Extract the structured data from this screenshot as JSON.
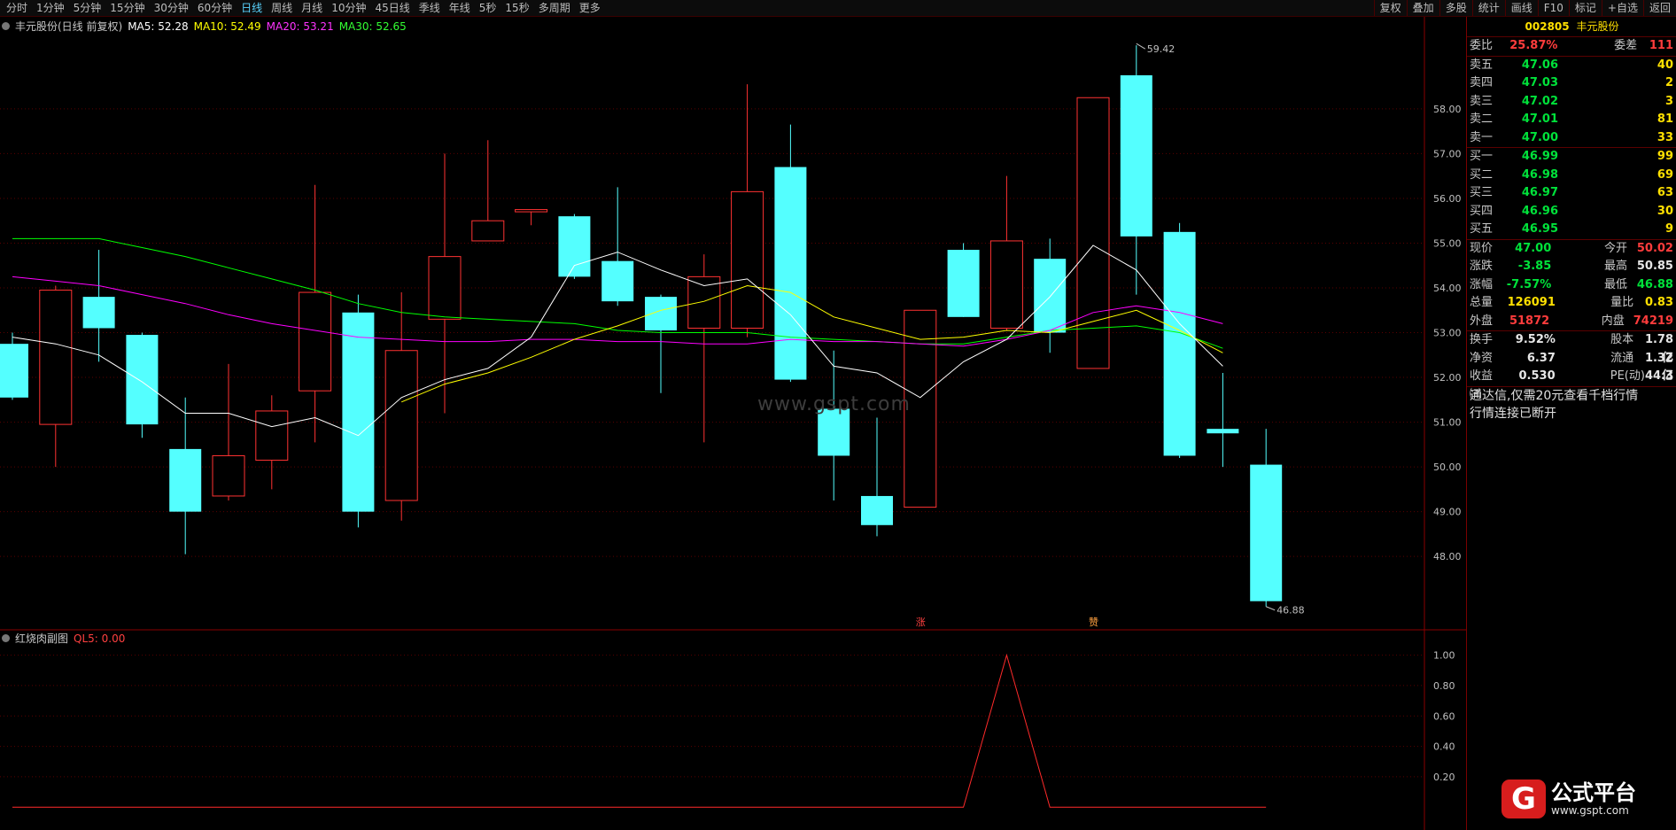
{
  "toolbar": {
    "periods": [
      "分时",
      "1分钟",
      "5分钟",
      "15分钟",
      "30分钟",
      "60分钟",
      "日线",
      "周线",
      "月线",
      "10分钟",
      "45日线",
      "季线",
      "年线",
      "5秒",
      "15秒",
      "多周期",
      "更多"
    ],
    "active_period": "日线",
    "buttons": [
      "复权",
      "叠加",
      "多股",
      "统计",
      "画线",
      "F10",
      "标记",
      "+自选",
      "返回"
    ]
  },
  "legend": {
    "title": "丰元股份(日线 前复权)",
    "ma5": "MA5: 52.28",
    "ma10": "MA10: 52.49",
    "ma20": "MA20: 53.21",
    "ma30": "MA30: 52.65"
  },
  "sub_legend": {
    "title": "红烧肉副图",
    "ql5": "QL5: 0.00"
  },
  "watermark": "www.gspt.com",
  "markers": {
    "rise": "涨",
    "other": "赞"
  },
  "high_label": "59.42",
  "low_label": "46.88",
  "colors": {
    "up": "#ff3232",
    "down": "#54ffff",
    "ma5": "#ffffff",
    "ma10": "#ffff00",
    "ma20": "#ff00ff",
    "ma30": "#00ff00",
    "grid": "#5a0000"
  },
  "chart_data": {
    "type": "candlestick",
    "y_ticks": [
      58.0,
      57.0,
      56.0,
      55.0,
      54.0,
      53.0,
      52.0,
      51.0,
      50.0,
      49.0,
      48.0
    ],
    "ylim": [
      46.4,
      59.7
    ],
    "candles": [
      {
        "o": 52.75,
        "c": 51.55,
        "h": 53.0,
        "l": 51.5
      },
      {
        "o": 50.95,
        "c": 53.95,
        "h": 54.05,
        "l": 50.0
      },
      {
        "o": 53.8,
        "c": 53.1,
        "h": 54.85,
        "l": 52.35
      },
      {
        "o": 52.95,
        "c": 50.95,
        "h": 53.0,
        "l": 50.65
      },
      {
        "o": 50.4,
        "c": 49.0,
        "h": 51.55,
        "l": 48.05
      },
      {
        "o": 49.35,
        "c": 50.25,
        "h": 52.3,
        "l": 49.25
      },
      {
        "o": 50.15,
        "c": 51.25,
        "h": 51.6,
        "l": 49.5
      },
      {
        "o": 51.7,
        "c": 53.9,
        "h": 56.3,
        "l": 50.55
      },
      {
        "o": 53.45,
        "c": 49.0,
        "h": 53.85,
        "l": 48.65
      },
      {
        "o": 49.25,
        "c": 52.6,
        "h": 53.9,
        "l": 48.8
      },
      {
        "o": 53.3,
        "c": 54.7,
        "h": 57.0,
        "l": 51.2
      },
      {
        "o": 55.05,
        "c": 55.5,
        "h": 57.3,
        "l": 55.05
      },
      {
        "o": 55.7,
        "c": 55.75,
        "h": 55.75,
        "l": 55.4
      },
      {
        "o": 55.6,
        "c": 54.25,
        "h": 55.65,
        "l": 54.2
      },
      {
        "o": 54.6,
        "c": 53.7,
        "h": 56.25,
        "l": 53.6
      },
      {
        "o": 53.8,
        "c": 53.05,
        "h": 53.85,
        "l": 51.65
      },
      {
        "o": 53.1,
        "c": 54.25,
        "h": 54.75,
        "l": 50.55
      },
      {
        "o": 53.1,
        "c": 56.15,
        "h": 58.55,
        "l": 52.9
      },
      {
        "o": 56.7,
        "c": 51.95,
        "h": 57.65,
        "l": 51.9
      },
      {
        "o": 51.3,
        "c": 50.25,
        "h": 52.6,
        "l": 49.25
      },
      {
        "o": 49.35,
        "c": 48.7,
        "h": 51.1,
        "l": 48.45
      },
      {
        "o": 49.1,
        "c": 53.5,
        "h": 53.5,
        "l": 49.1
      },
      {
        "o": 54.85,
        "c": 53.35,
        "h": 55.0,
        "l": 53.35
      },
      {
        "o": 53.1,
        "c": 55.05,
        "h": 56.5,
        "l": 53.05
      },
      {
        "o": 54.65,
        "c": 53.0,
        "h": 55.1,
        "l": 52.55
      },
      {
        "o": 52.2,
        "c": 58.25,
        "h": 58.25,
        "l": 52.2
      },
      {
        "o": 58.75,
        "c": 55.15,
        "h": 59.42,
        "l": 53.85
      },
      {
        "o": 55.25,
        "c": 50.25,
        "h": 55.45,
        "l": 50.2
      },
      {
        "o": 50.85,
        "c": 50.75,
        "h": 52.1,
        "l": 50.0
      },
      {
        "o": 50.05,
        "c": 47.0,
        "h": 50.85,
        "l": 46.88
      }
    ],
    "ma5": [
      52.9,
      52.75,
      52.5,
      51.9,
      51.2,
      51.2,
      50.9,
      51.1,
      50.7,
      51.55,
      51.95,
      52.2,
      52.9,
      54.5,
      54.8,
      54.4,
      54.05,
      54.2,
      53.4,
      52.25,
      52.1,
      51.55,
      52.35,
      52.85,
      53.8,
      54.95,
      54.4,
      53.2,
      52.25
    ],
    "ma10": [
      null,
      null,
      null,
      null,
      null,
      null,
      null,
      null,
      null,
      51.45,
      51.85,
      52.1,
      52.45,
      52.85,
      53.15,
      53.5,
      53.7,
      54.05,
      53.9,
      53.35,
      53.1,
      52.85,
      52.9,
      53.05,
      53.0,
      53.25,
      53.5,
      53.05,
      52.55
    ],
    "ma20": [
      54.25,
      54.15,
      54.05,
      53.85,
      53.65,
      53.4,
      53.2,
      53.05,
      52.9,
      52.85,
      52.8,
      52.8,
      52.85,
      52.85,
      52.8,
      52.8,
      52.75,
      52.75,
      52.85,
      52.8,
      52.8,
      52.75,
      52.7,
      52.85,
      53.05,
      53.45,
      53.6,
      53.45,
      53.2
    ],
    "ma30": [
      55.1,
      55.1,
      55.1,
      54.9,
      54.7,
      54.45,
      54.2,
      53.95,
      53.65,
      53.45,
      53.35,
      53.3,
      53.25,
      53.2,
      53.05,
      53.0,
      53.0,
      53.0,
      52.9,
      52.85,
      52.8,
      52.75,
      52.75,
      52.9,
      53.05,
      53.1,
      53.15,
      53.0,
      52.65
    ],
    "sub": {
      "y_ticks": [
        1.0,
        0.8,
        0.6,
        0.4,
        0.2
      ],
      "ylim": [
        -0.15,
        1.05
      ],
      "ql5": [
        0,
        0,
        0,
        0,
        0,
        0,
        0,
        0,
        0,
        0,
        0,
        0,
        0,
        0,
        0,
        0,
        0,
        0,
        0,
        0,
        0,
        0,
        0,
        1,
        0,
        0,
        0,
        0,
        0,
        0
      ]
    }
  },
  "sidebar": {
    "code": "002805",
    "name": "丰元股份",
    "webi": {
      "label": "委比",
      "value": "25.87%",
      "label2": "委差",
      "value2": "111"
    },
    "asks": [
      {
        "label": "卖五",
        "price": "47.06",
        "vol": "40"
      },
      {
        "label": "卖四",
        "price": "47.03",
        "vol": "2"
      },
      {
        "label": "卖三",
        "price": "47.02",
        "vol": "3"
      },
      {
        "label": "卖二",
        "price": "47.01",
        "vol": "81"
      },
      {
        "label": "卖一",
        "price": "47.00",
        "vol": "33"
      }
    ],
    "bids": [
      {
        "label": "买一",
        "price": "46.99",
        "vol": "99"
      },
      {
        "label": "买二",
        "price": "46.98",
        "vol": "69"
      },
      {
        "label": "买三",
        "price": "46.97",
        "vol": "63"
      },
      {
        "label": "买四",
        "price": "46.96",
        "vol": "30"
      },
      {
        "label": "买五",
        "price": "46.95",
        "vol": "9"
      }
    ],
    "stats": [
      {
        "l1": "现价",
        "v1": "47.00",
        "l2": "今开",
        "v2": "50.02",
        "c1": "green",
        "c2": "red"
      },
      {
        "l1": "涨跌",
        "v1": "-3.85",
        "l2": "最高",
        "v2": "50.85",
        "c1": "green",
        "c2": "wht"
      },
      {
        "l1": "涨幅",
        "v1": "-7.57%",
        "l2": "最低",
        "v2": "46.88",
        "c1": "green",
        "c2": "green"
      },
      {
        "l1": "总量",
        "v1": "126091",
        "l2": "量比",
        "v2": "0.83",
        "c1": "yel",
        "c2": "yel"
      },
      {
        "l1": "外盘",
        "v1": "51872",
        "l2": "内盘",
        "v2": "74219",
        "c1": "red",
        "c2": "red"
      }
    ],
    "stats2": [
      {
        "l1": "换手",
        "v1": "9.52%",
        "l2": "股本",
        "v2": "1.78亿"
      },
      {
        "l1": "净资",
        "v1": "6.37",
        "l2": "流通",
        "v2": "1.32亿"
      },
      {
        "l1": "收益㈢",
        "v1": "0.530",
        "l2": "PE(动)",
        "v2": "44.3"
      }
    ],
    "notice": "通达信,仅需20元查看千档行情",
    "status": "行情连接已断开"
  },
  "logo": {
    "title": "公式平台",
    "url": "www.gspt.com",
    "mark": "G"
  }
}
